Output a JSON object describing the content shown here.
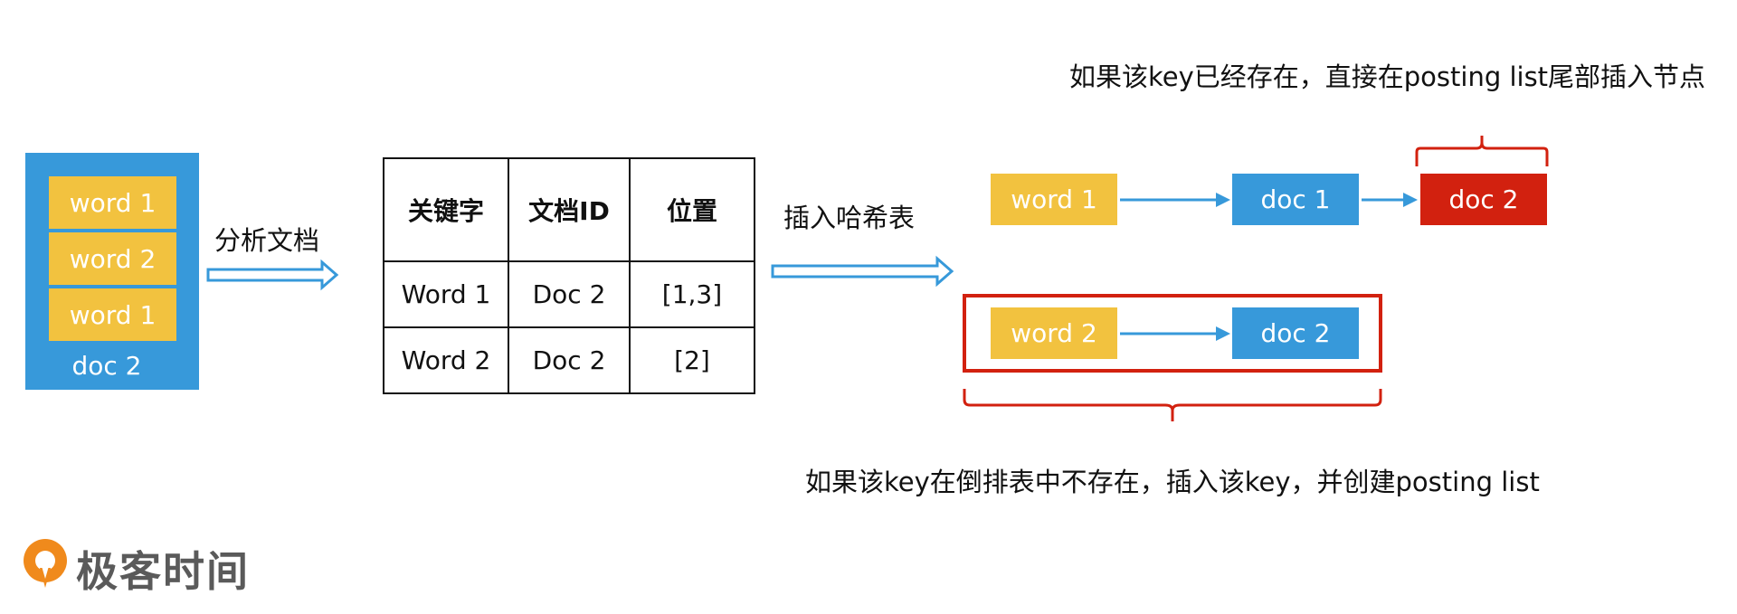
{
  "doc_card": {
    "words": [
      "word 1",
      "word 2",
      "word 1"
    ],
    "doc_label": "doc 2"
  },
  "step1_label": "分析文档",
  "step2_label": "插入哈希表",
  "index_table": {
    "headers": [
      "关键字",
      "文档ID",
      "位置"
    ],
    "rows": [
      [
        "Word 1",
        "Doc 2",
        "[1,3]"
      ],
      [
        "Word 2",
        "Doc 2",
        "[2]"
      ]
    ]
  },
  "hash_table": {
    "row1": {
      "key": "word 1",
      "node1": "doc 1",
      "node2": "doc 2"
    },
    "row2": {
      "key": "word 2",
      "node1": "doc 2"
    }
  },
  "annotations": {
    "top": "如果该key已经存在，直接在posting list尾部插入节点",
    "bottom": "如果该key在倒排表中不存在，插入该key，并创建posting list"
  },
  "brand": {
    "name": "极客时间"
  },
  "colors": {
    "yellow": "#f2c23f",
    "blue": "#3799da",
    "red": "#d2210f",
    "arrow": "#3799da"
  }
}
